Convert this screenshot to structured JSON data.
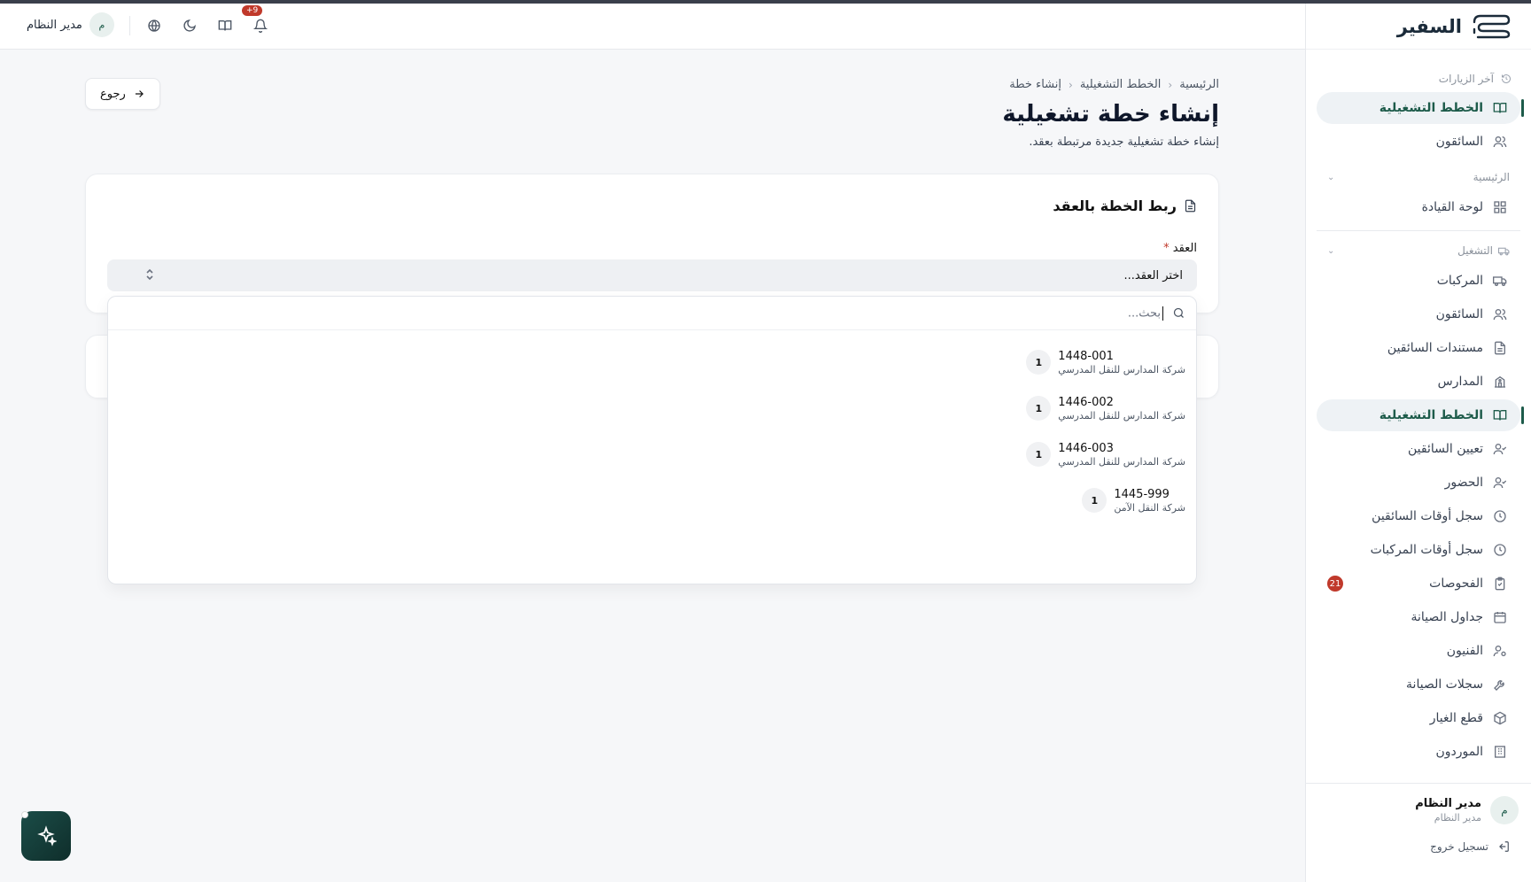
{
  "brand": {
    "name": "السفير"
  },
  "topbar": {
    "user_initial": "م",
    "user_name": "مدير النظام",
    "notif_count": "+9",
    "icons": [
      "globe-icon",
      "moon-icon",
      "book-icon",
      "bell-icon"
    ]
  },
  "sidebar": {
    "recent_label": "آخر الزيارات",
    "recent_items": [
      {
        "label": "الخطط التشغيلية",
        "icon": "book-icon",
        "active": true
      },
      {
        "label": "السائقون",
        "icon": "users-icon",
        "active": false
      }
    ],
    "group_main": "الرئيسية",
    "main_items": [
      {
        "label": "لوحة القيادة",
        "icon": "dashboard-icon"
      }
    ],
    "group_ops": "التشغيل",
    "ops_items": [
      {
        "label": "المركبات",
        "icon": "truck-icon"
      },
      {
        "label": "السائقون",
        "icon": "users-icon"
      },
      {
        "label": "مستندات السائقين",
        "icon": "file-icon"
      },
      {
        "label": "المدارس",
        "icon": "school-icon"
      },
      {
        "label": "الخطط التشغيلية",
        "icon": "book-icon",
        "active": true
      },
      {
        "label": "تعيين السائقين",
        "icon": "user-check-icon"
      },
      {
        "label": "الحضور",
        "icon": "user-check-icon"
      },
      {
        "label": "سجل أوقات السائقين",
        "icon": "clock-icon"
      },
      {
        "label": "سجل أوقات المركبات",
        "icon": "clock-icon"
      },
      {
        "label": "الفحوصات",
        "icon": "clipboard-icon",
        "badge": "21"
      },
      {
        "label": "جداول الصيانة",
        "icon": "calendar-icon"
      },
      {
        "label": "الفنيون",
        "icon": "user-gear-icon"
      },
      {
        "label": "سجلات الصيانة",
        "icon": "wrench-icon"
      },
      {
        "label": "قطع الغيار",
        "icon": "box-icon"
      },
      {
        "label": "الموردون",
        "icon": "building-icon"
      }
    ],
    "user": {
      "initial": "م",
      "name": "مدير النظام",
      "role": "مدير النظام"
    },
    "logout_label": "تسجيل خروج"
  },
  "page": {
    "breadcrumb": [
      "الرئيسية",
      "الخطط التشغيلية",
      "إنشاء خطة"
    ],
    "title": "إنشاء خطة تشغيلية",
    "subtitle": "إنشاء خطة تشغيلية جديدة مرتبطة بعقد.",
    "back_label": "رجوع"
  },
  "form": {
    "card_title": "ربط الخطة بالعقد",
    "contract_label": "العقد",
    "required_mark": "*",
    "contract_placeholder": "اختر العقد..."
  },
  "dropdown": {
    "search_placeholder": "بحث...",
    "items": [
      {
        "code": "1448-001",
        "company": "شركة المدارس للنقل المدرسي",
        "count": "1"
      },
      {
        "code": "1446-002",
        "company": "شركة المدارس للنقل المدرسي",
        "count": "1"
      },
      {
        "code": "1446-003",
        "company": "شركة المدارس للنقل المدرسي",
        "count": "1"
      },
      {
        "code": "1445-999",
        "company": "شركة النقل الآمن",
        "count": "1"
      }
    ]
  },
  "colors": {
    "accent": "#1d5b4a",
    "badge": "#c0392b",
    "brand_dark": "#1b2b3a"
  }
}
